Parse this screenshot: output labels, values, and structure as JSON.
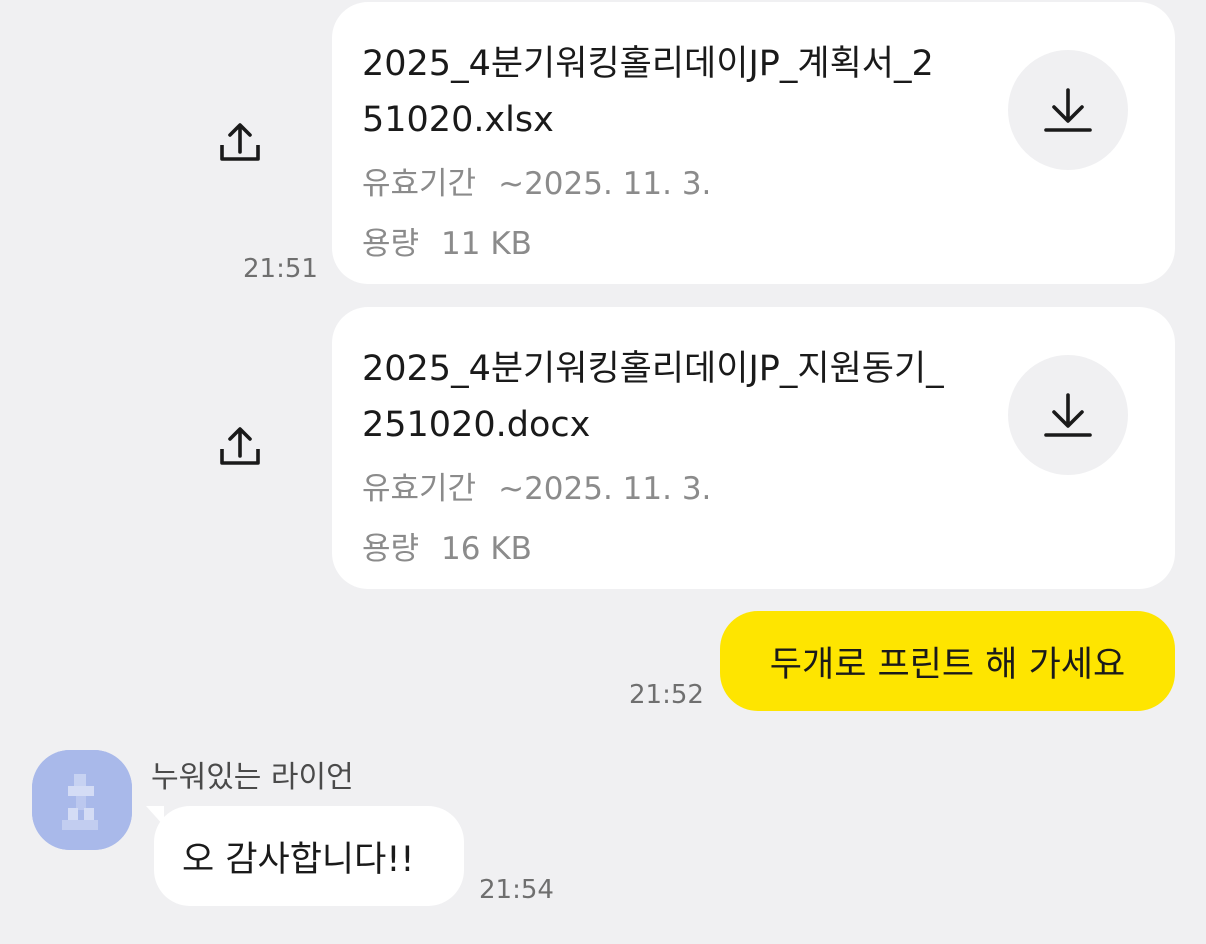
{
  "messages": {
    "file1": {
      "name": "2025_4분기워킹홀리데이JP_계획서_251020.xlsx",
      "expiry_label": "유효기간",
      "expiry_value": "~2025. 11. 3.",
      "size_label": "용량",
      "size_value": "11 KB",
      "time": "21:51",
      "download_icon": "download-icon",
      "share_icon": "share-icon"
    },
    "file2": {
      "name": "2025_4분기워킹홀리데이JP_지원동기_251020.docx",
      "expiry_label": "유효기간",
      "expiry_value": "~2025. 11. 3.",
      "size_label": "용량",
      "size_value": "16 KB",
      "download_icon": "download-icon",
      "share_icon": "share-icon"
    },
    "sent_text": {
      "text": "두개로 프린트 해 가세요",
      "time": "21:52"
    },
    "received_text": {
      "sender": "누워있는 라이언",
      "text": "오 감사합니다!!",
      "time": "21:54",
      "avatar_icon": "profile-avatar"
    }
  },
  "colors": {
    "background": "#f0f0f2",
    "my_bubble": "#fee500",
    "their_bubble": "#ffffff",
    "avatar_bg": "#a9b9ea"
  }
}
